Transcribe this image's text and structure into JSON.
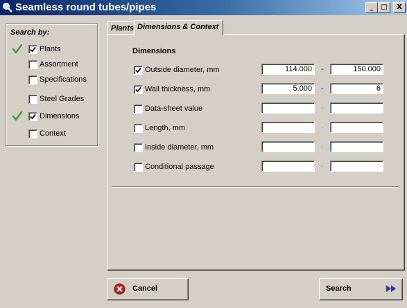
{
  "window": {
    "title": "Seamless round tubes/pipes",
    "controls": {
      "minimize": "_",
      "maximize": "□",
      "close": "X"
    }
  },
  "search_by": {
    "title": "Search by:",
    "items": [
      {
        "label": "Plants",
        "checked": true,
        "marked": true
      },
      {
        "label": "Assortment",
        "checked": false,
        "marked": false
      },
      {
        "label": "Specifications",
        "checked": false,
        "marked": false
      },
      {
        "label": "Steel Grades",
        "checked": false,
        "marked": false
      },
      {
        "label": "Dimensions",
        "checked": true,
        "marked": true
      },
      {
        "label": "Context",
        "checked": false,
        "marked": false
      }
    ]
  },
  "tabs": [
    {
      "label": "Plants",
      "active": false
    },
    {
      "label": "Dimensions & Context",
      "active": true
    }
  ],
  "dimensions": {
    "title": "Dimensions",
    "rows": [
      {
        "label": "Outside diameter, mm",
        "checked": true,
        "from": "114.000",
        "to": "150.000",
        "dash": "-"
      },
      {
        "label": "Wall thickness, mm",
        "checked": true,
        "from": "5.000",
        "to": "6",
        "dash": "-"
      },
      {
        "label": "Data-sheet value",
        "checked": false,
        "from": "",
        "to": "",
        "dash": "-"
      },
      {
        "label": "Length, mm",
        "checked": false,
        "from": "",
        "to": "",
        "dash": "-"
      },
      {
        "label": "Inside diameter, mm",
        "checked": false,
        "from": "",
        "to": "",
        "dash": "-"
      },
      {
        "label": "Conditional passage",
        "checked": false,
        "from": "",
        "to": "",
        "dash": "-"
      }
    ]
  },
  "buttons": {
    "cancel": {
      "label": "Cancel",
      "icon": "cancel-icon"
    },
    "search": {
      "label": "Search",
      "icon": "fast-forward-icon"
    }
  },
  "colors": {
    "title_gradient_start": "#0a246a",
    "title_gradient_end": "#a6caf0",
    "checkmark_green": "#3aa22b",
    "cancel_red": "#c0201a",
    "search_arrow_blue": "#2c3aa8"
  }
}
